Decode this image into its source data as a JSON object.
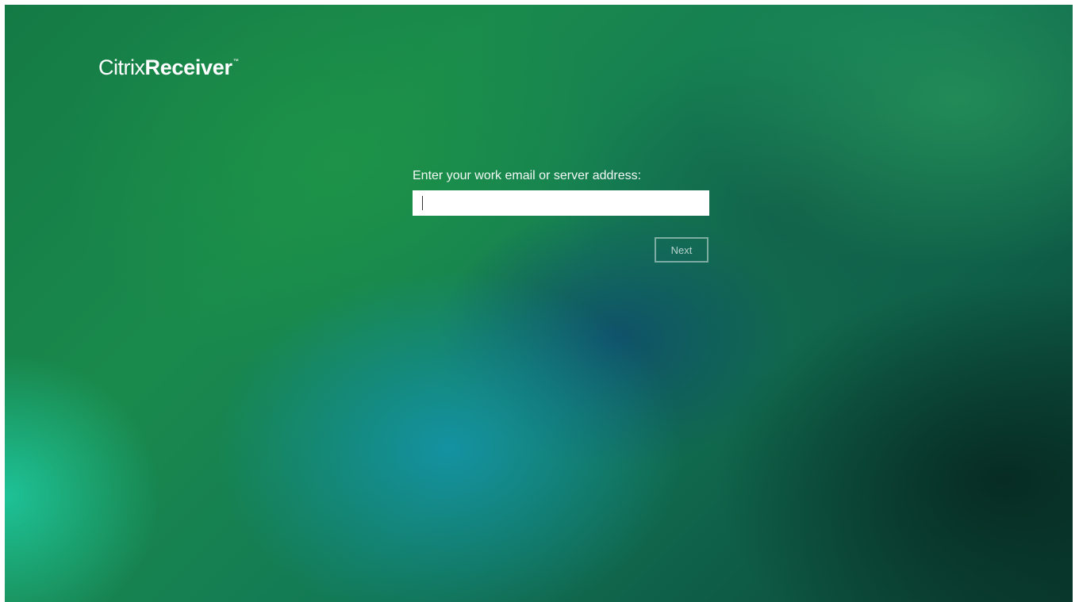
{
  "app": {
    "logo_brand": "Citrix",
    "logo_product": "Receiver",
    "logo_tm": "™"
  },
  "signin": {
    "prompt": "Enter your work email or server address:",
    "input_value": "",
    "next_label": "Next",
    "next_enabled": false
  },
  "colors": {
    "background_primary": "#1a8a4c",
    "background_accent": "#1496af",
    "text": "#ffffff"
  }
}
